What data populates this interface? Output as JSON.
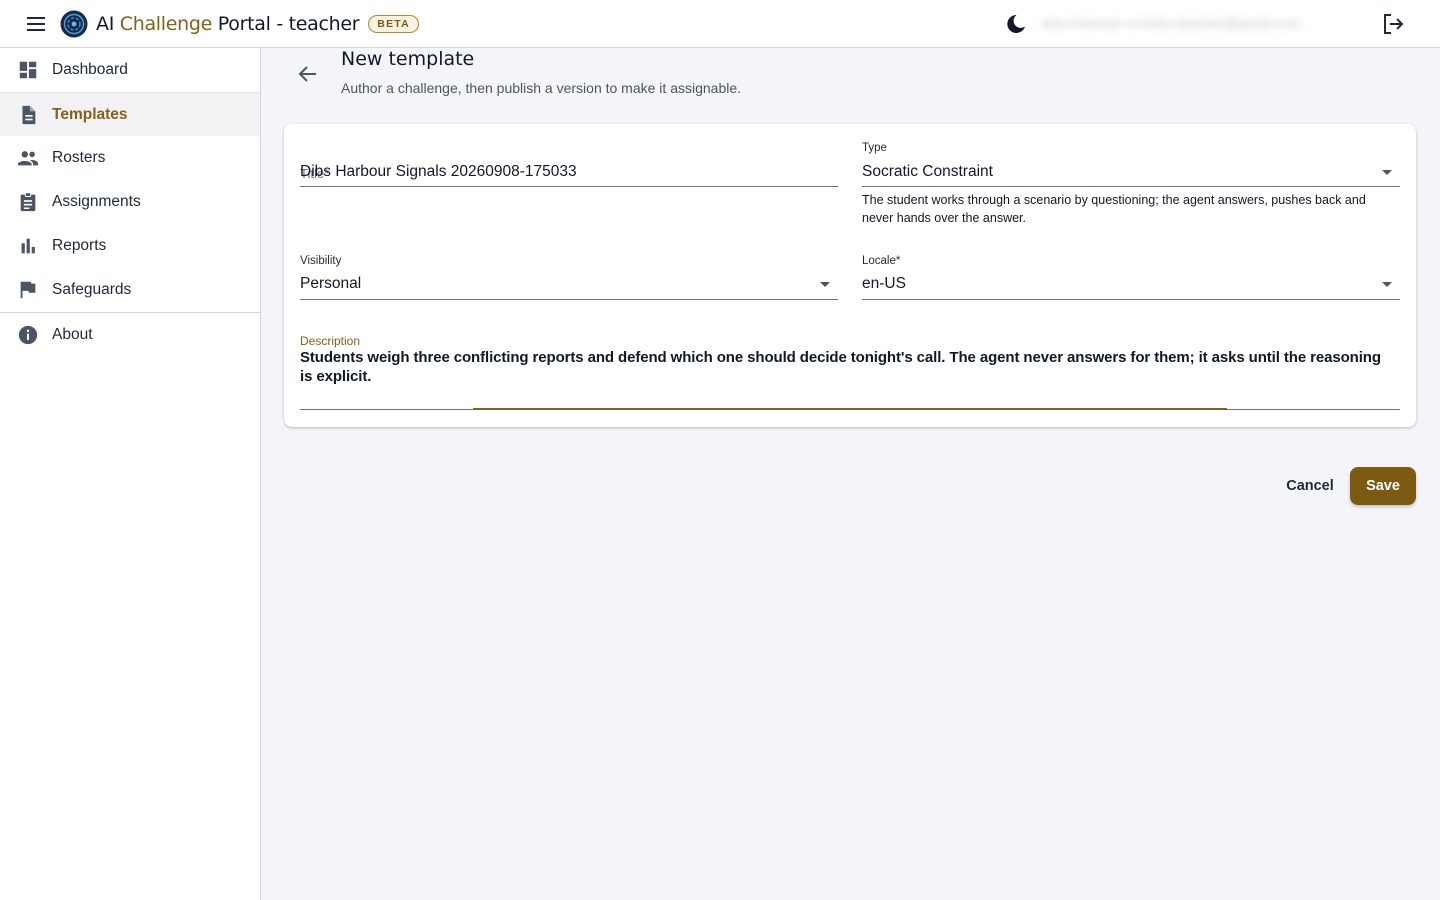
{
  "app": {
    "title_part1": "AI ",
    "title_accent": "Challenge",
    "title_part2": " Portal - teacher",
    "badge": "BETA",
    "user_email": "alex.freeman.sr.hebe.teacher@gmail.com",
    "brand_color": "#85601a"
  },
  "icons": {
    "menu": "menu-icon",
    "logo": "logo-icon",
    "theme": "moon-icon",
    "logout": "logout-icon",
    "back": "arrow-back-icon"
  },
  "sidebar": {
    "items": [
      {
        "label": "Dashboard",
        "icon": "dashboard-icon"
      },
      {
        "label": "Templates",
        "icon": "document-icon"
      },
      {
        "label": "Rosters",
        "icon": "people-icon"
      },
      {
        "label": "Assignments",
        "icon": "clipboard-icon"
      },
      {
        "label": "Reports",
        "icon": "bar-chart-icon"
      },
      {
        "label": "Safeguards",
        "icon": "flag-icon"
      },
      {
        "label": "About",
        "icon": "info-icon"
      }
    ],
    "active": "Templates"
  },
  "page": {
    "title": "New template",
    "subtitle": "Author a challenge, then publish a version to make it assignable."
  },
  "form": {
    "title_label": "Title*",
    "title_value": "Dibs Harbour Signals 20260908-175033",
    "type_label": "Type",
    "type_value": "Socratic Constraint",
    "type_hint": "The student works through a scenario by questioning; the agent answers, pushes back and never hands over the answer.",
    "visibility_label": "Visibility",
    "visibility_value": "Personal",
    "locale_label": "Locale*",
    "locale_value": "en-US",
    "description_label": "Description",
    "description_value": "Students weigh three conflicting reports and defend which one should decide tonight's call. The agent never answers for them; it asks until the reasoning is explicit."
  },
  "actions": {
    "cancel": "Cancel",
    "save": "Save"
  }
}
